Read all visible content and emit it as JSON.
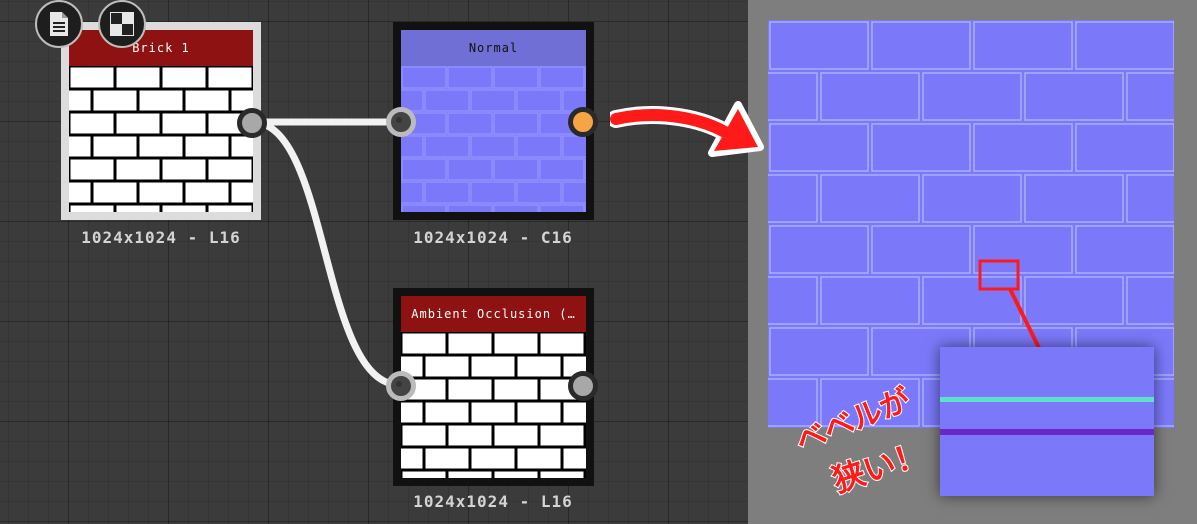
{
  "toolbar": {
    "buttons": [
      {
        "name": "document-icon"
      },
      {
        "name": "checker-pattern-icon"
      }
    ]
  },
  "nodes": {
    "brick": {
      "title": "Brick 1",
      "caption": "1024x1024 - L16"
    },
    "normal": {
      "title": "Normal",
      "caption": "1024x1024 - C16"
    },
    "ao": {
      "title": "Ambient Occlusion (…",
      "caption": "1024x1024 - L16"
    }
  },
  "annotation": {
    "line1": "ベベルが",
    "line2": "狭い！"
  },
  "colors": {
    "node_header_red": "#8e1212",
    "normal_blue": "#7b79f9",
    "normal_header": "#6f6fd6",
    "output_port_orange": "#f6a444",
    "arrow_red": "#ff1a1a",
    "highlight_cyan": "#5fe0c8",
    "shadow_purple": "#6a28c8"
  }
}
